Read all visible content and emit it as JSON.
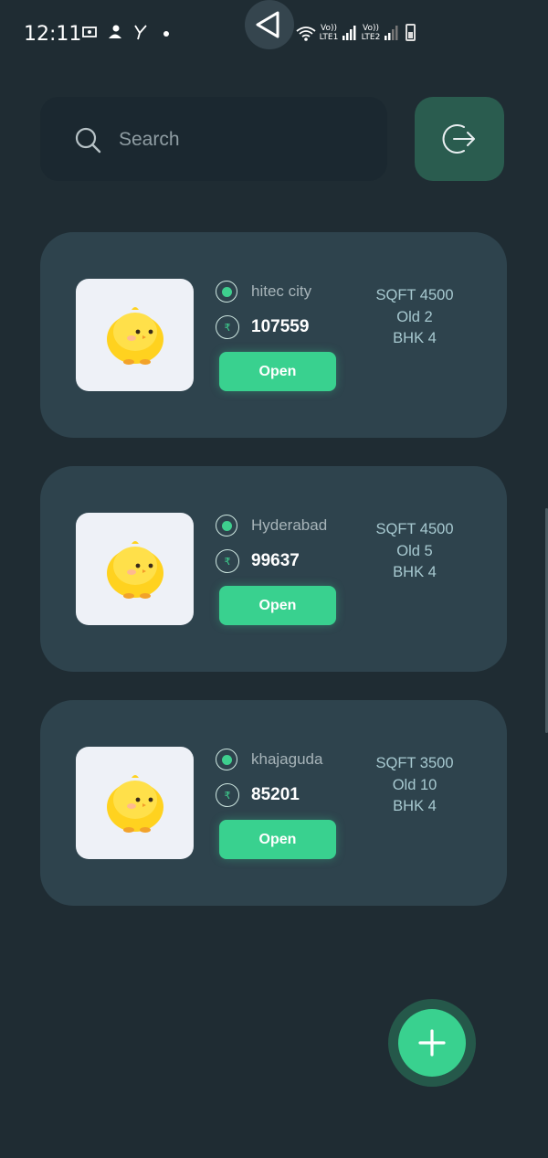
{
  "status_bar": {
    "time": "12:11",
    "sim1": "Vo)) LTE1",
    "sim2": "Vo)) LTE2"
  },
  "search": {
    "placeholder": "Search"
  },
  "icons": {
    "search": "search-icon",
    "logout": "logout-icon",
    "location": "location-dot-icon",
    "rupee": "rupee-icon",
    "add": "plus-icon",
    "thumbnail": "yellow-chick-image"
  },
  "colors": {
    "background": "#1f2c33",
    "card": "#2e434d",
    "accent": "#39d18f",
    "logout_button": "#2a5c4f"
  },
  "currency_symbol": "₹",
  "properties": [
    {
      "location": "hitec city",
      "price": "107559",
      "open_label": "Open",
      "sqft": "SQFT 4500",
      "old": "Old 2",
      "bhk": "BHK 4"
    },
    {
      "location": "Hyderabad",
      "price": "99637",
      "open_label": "Open",
      "sqft": "SQFT 4500",
      "old": "Old 5",
      "bhk": "BHK 4"
    },
    {
      "location": "khajaguda",
      "price": "85201",
      "open_label": "Open",
      "sqft": "SQFT 3500",
      "old": "Old 10",
      "bhk": "BHK 4"
    }
  ]
}
